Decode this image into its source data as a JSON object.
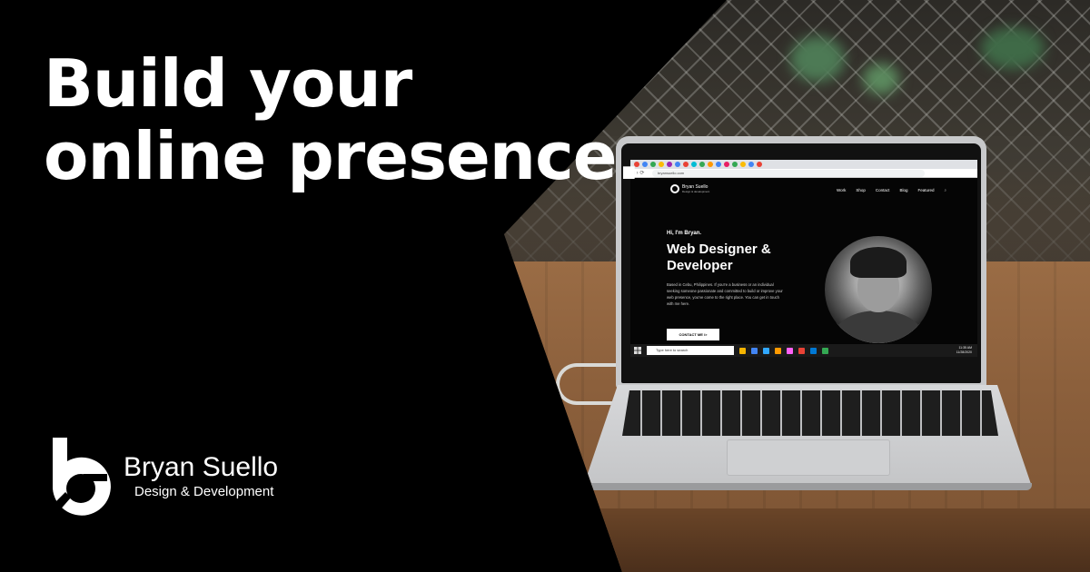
{
  "headline": {
    "line1": "Build your",
    "line2": "online presence."
  },
  "brand": {
    "name": "Bryan Suello",
    "tagline": "Design & Development",
    "logo_icon": "b-monogram-logo-icon"
  },
  "laptop_screen": {
    "address": "bryansuello.com",
    "site_logo_name": "Bryan Suello",
    "site_logo_tagline": "Design & development",
    "nav": [
      "Work",
      "Shop",
      "Contact",
      "Blog",
      "Featured"
    ],
    "greeting": "Hi, I'm Bryan.",
    "title": "Web Designer & Developer",
    "intro": "Based in Cebu, Philippines. If you're a business or an individual seeking someone passionate and committed to build or improve your web presence, you've come to the right place. You can get in touch with me here.",
    "cta": "CONTACT ME />",
    "taskbar_search": "Type here to search",
    "clock_time": "11:35 AM",
    "clock_date": "11/28/2020"
  },
  "colors": {
    "background": "#000000",
    "text": "#ffffff"
  }
}
